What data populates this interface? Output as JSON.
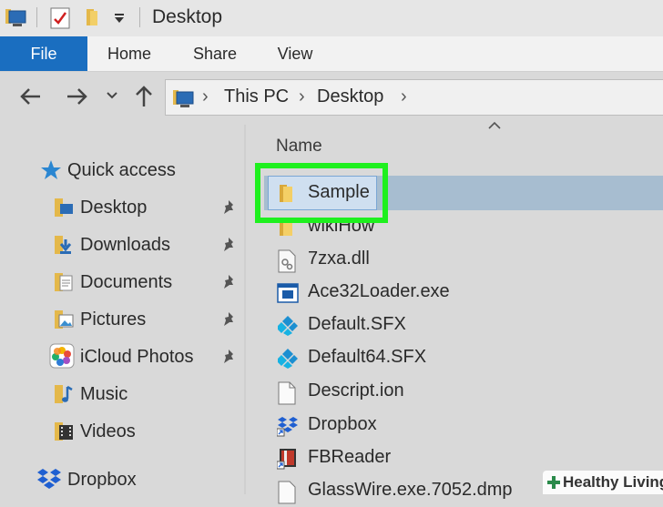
{
  "window": {
    "title": "Desktop"
  },
  "ribbon": {
    "tabs": [
      "File",
      "Home",
      "Share",
      "View"
    ]
  },
  "address": {
    "crumbs": [
      "This PC",
      "Desktop"
    ]
  },
  "sidebar": {
    "quick_access": "Quick access",
    "items": [
      {
        "label": "Desktop",
        "icon": "desktop-folder-icon",
        "pinned": true
      },
      {
        "label": "Downloads",
        "icon": "downloads-folder-icon",
        "pinned": true
      },
      {
        "label": "Documents",
        "icon": "documents-folder-icon",
        "pinned": true
      },
      {
        "label": "Pictures",
        "icon": "pictures-folder-icon",
        "pinned": true
      },
      {
        "label": "iCloud Photos",
        "icon": "icloud-photos-icon",
        "pinned": true
      },
      {
        "label": "Music",
        "icon": "music-folder-icon",
        "pinned": false
      },
      {
        "label": "Videos",
        "icon": "videos-folder-icon",
        "pinned": false
      }
    ],
    "dropbox": "Dropbox"
  },
  "filelist": {
    "column_header": "Name",
    "files": [
      {
        "name": "Sample",
        "icon": "folder-icon",
        "selected": true
      },
      {
        "name": "wikiHow",
        "icon": "folder-icon"
      },
      {
        "name": "7zxa.dll",
        "icon": "dll-file-icon"
      },
      {
        "name": "Ace32Loader.exe",
        "icon": "exe-file-icon"
      },
      {
        "name": "Default.SFX",
        "icon": "kodi-file-icon"
      },
      {
        "name": "Default64.SFX",
        "icon": "kodi-file-icon"
      },
      {
        "name": "Descript.ion",
        "icon": "blank-file-icon"
      },
      {
        "name": "Dropbox",
        "icon": "dropbox-icon"
      },
      {
        "name": "FBReader",
        "icon": "fbreader-icon"
      },
      {
        "name": "GlassWire.exe.7052.dmp",
        "icon": "blank-file-icon"
      }
    ]
  },
  "watermark": {
    "text": "Healthy Living"
  },
  "colors": {
    "accent": "#1a6ec0",
    "highlight": "#1ef01e",
    "selection": "#a7bdd0"
  }
}
